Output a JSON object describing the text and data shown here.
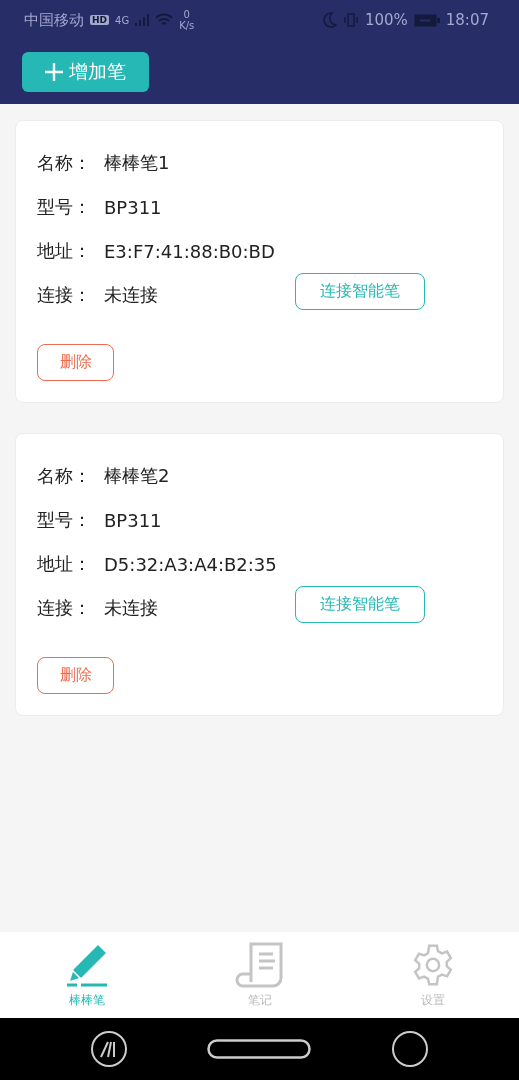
{
  "status_bar": {
    "carrier": "中国移动",
    "network_badge": "HD",
    "network": "4G",
    "speed_value": "0",
    "speed_unit": "K/s",
    "battery": "100%",
    "time": "18:07"
  },
  "header": {
    "add_button": {
      "label": "增加笔"
    }
  },
  "pens": [
    {
      "fields": [
        {
          "label": "名称：",
          "value": "棒棒笔1"
        },
        {
          "label": "型号：",
          "value": "BP311"
        },
        {
          "label": "地址：",
          "value": "E3:F7:41:88:B0:BD"
        },
        {
          "label": "连接：",
          "value": "未连接"
        }
      ],
      "connect_button": "连接智能笔",
      "delete_button": "删除"
    },
    {
      "fields": [
        {
          "label": "名称：",
          "value": "棒棒笔2"
        },
        {
          "label": "型号：",
          "value": "BP311"
        },
        {
          "label": "地址：",
          "value": "D5:32:A3:A4:B2:35"
        },
        {
          "label": "连接：",
          "value": "未连接"
        }
      ],
      "connect_button": "连接智能笔",
      "delete_button": "删除"
    }
  ],
  "bottom_nav": [
    {
      "kind": "pen",
      "label": "棒棒笔",
      "selected": true
    },
    {
      "kind": "notes",
      "label": "笔记",
      "selected": false
    },
    {
      "kind": "settings",
      "label": "设置",
      "selected": false
    }
  ]
}
